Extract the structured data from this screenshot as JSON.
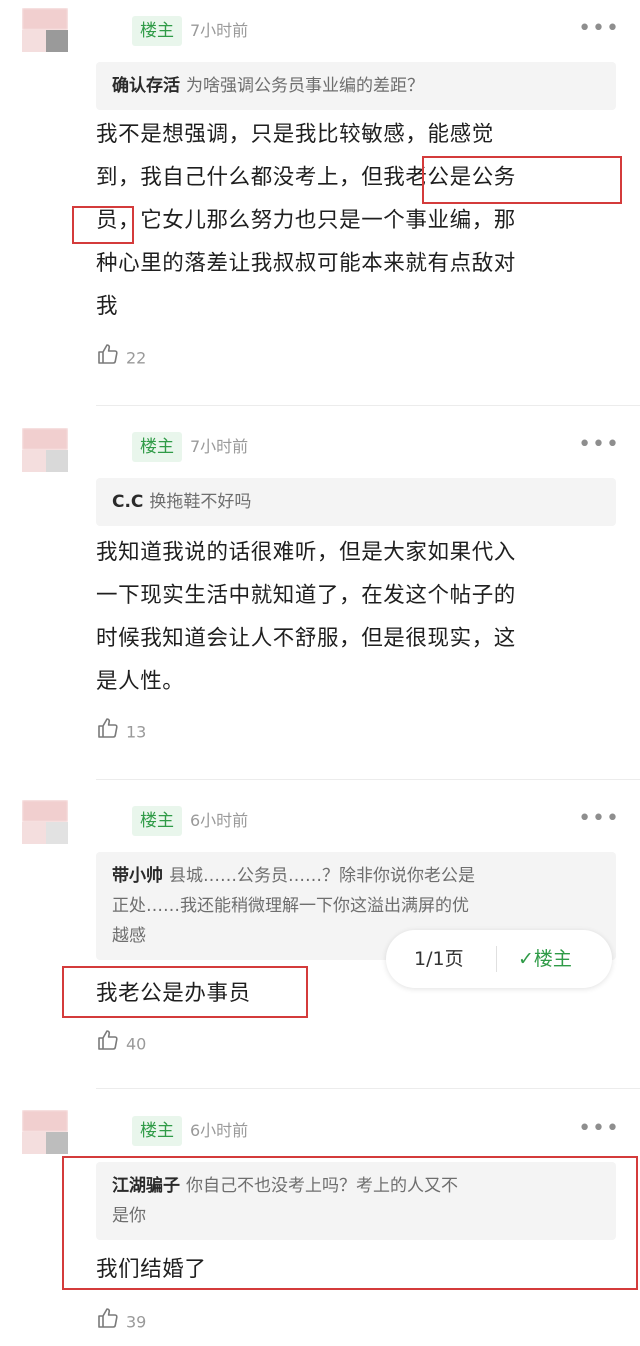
{
  "comments": [
    {
      "badge": "楼主",
      "time": "7小时前",
      "more": "•••",
      "quote_name": "确认存活",
      "quote_text": "为啥强调公务员事业编的差距？",
      "body_lines": [
        "我不是想强调，只是我比较敏感，能感觉",
        "到，我自己什么都没考上，但我老公是公务",
        "员，它女儿那么努力也只是一个事业编，那",
        "种心里的落差让我叔叔可能本来就有点敌对",
        "我"
      ],
      "likes": "22"
    },
    {
      "badge": "楼主",
      "time": "7小时前",
      "more": "•••",
      "quote_name": "C.C",
      "quote_text": "换拖鞋不好吗",
      "body_lines": [
        "我知道我说的话很难听，但是大家如果代入",
        "一下现实生活中就知道了，在发这个帖子的",
        "时候我知道会让人不舒服，但是很现实，这",
        "是人性。"
      ],
      "likes": "13"
    },
    {
      "badge": "楼主",
      "time": "6小时前",
      "more": "•••",
      "quote_name": "带小帅",
      "quote_lines": [
        "县城……公务员……？除非你说你老公是",
        "正处……我还能稍微理解一下你这溢出满屏的优",
        "越感"
      ],
      "body_lines": [
        "我老公是办事员"
      ],
      "likes": "40"
    },
    {
      "badge": "楼主",
      "time": "6小时前",
      "more": "•••",
      "quote_name": "江湖骗子",
      "quote_lines": [
        "你自己不也没考上吗？考上的人又不",
        "是你"
      ],
      "body_lines": [
        "我们结婚了"
      ],
      "likes": "39"
    }
  ],
  "pager": {
    "page": "1/1页",
    "op": "✓楼主"
  },
  "colors": {
    "badge_green": "#2f9b47",
    "highlight_red": "#d43b3b"
  }
}
